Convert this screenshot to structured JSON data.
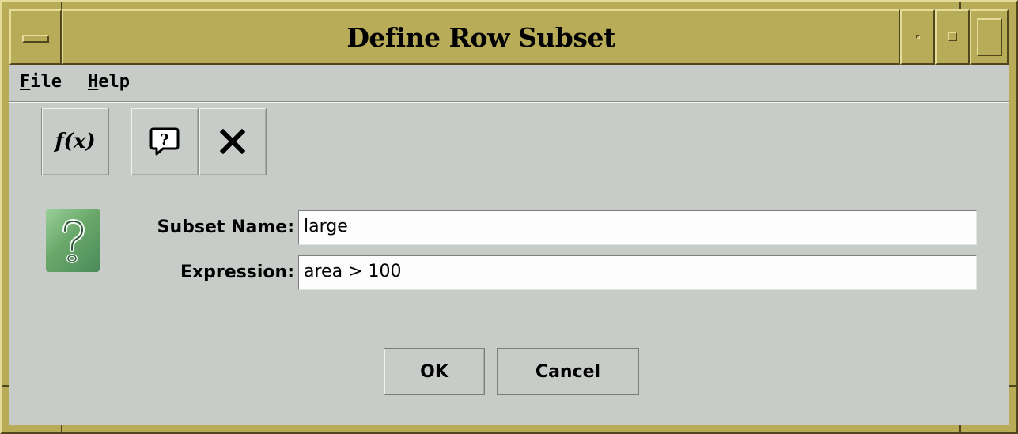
{
  "window": {
    "title": "Define Row Subset",
    "controls": [
      "window-menu-icon",
      "minimize-icon",
      "maximize-icon",
      "close-icon"
    ]
  },
  "menubar": {
    "items": [
      {
        "label": "File",
        "mnemonic": "F"
      },
      {
        "label": "Help",
        "mnemonic": "H"
      }
    ]
  },
  "toolbar": {
    "tools": [
      {
        "icon": "function-icon",
        "glyph": "f(x)"
      },
      {
        "icon": "help-icon"
      },
      {
        "icon": "close-icon"
      }
    ]
  },
  "form": {
    "icon": "question-icon",
    "subset_name_label": "Subset Name:",
    "subset_name_value": "large",
    "expression_label": "Expression:",
    "expression_value": "area > 100"
  },
  "buttons": {
    "ok": "OK",
    "cancel": "Cancel"
  },
  "colors": {
    "frame": "#b8ac58",
    "background": "#c8ccc8",
    "field_bg": "#fcfdfc",
    "help_icon_green": "#6aa86a"
  }
}
